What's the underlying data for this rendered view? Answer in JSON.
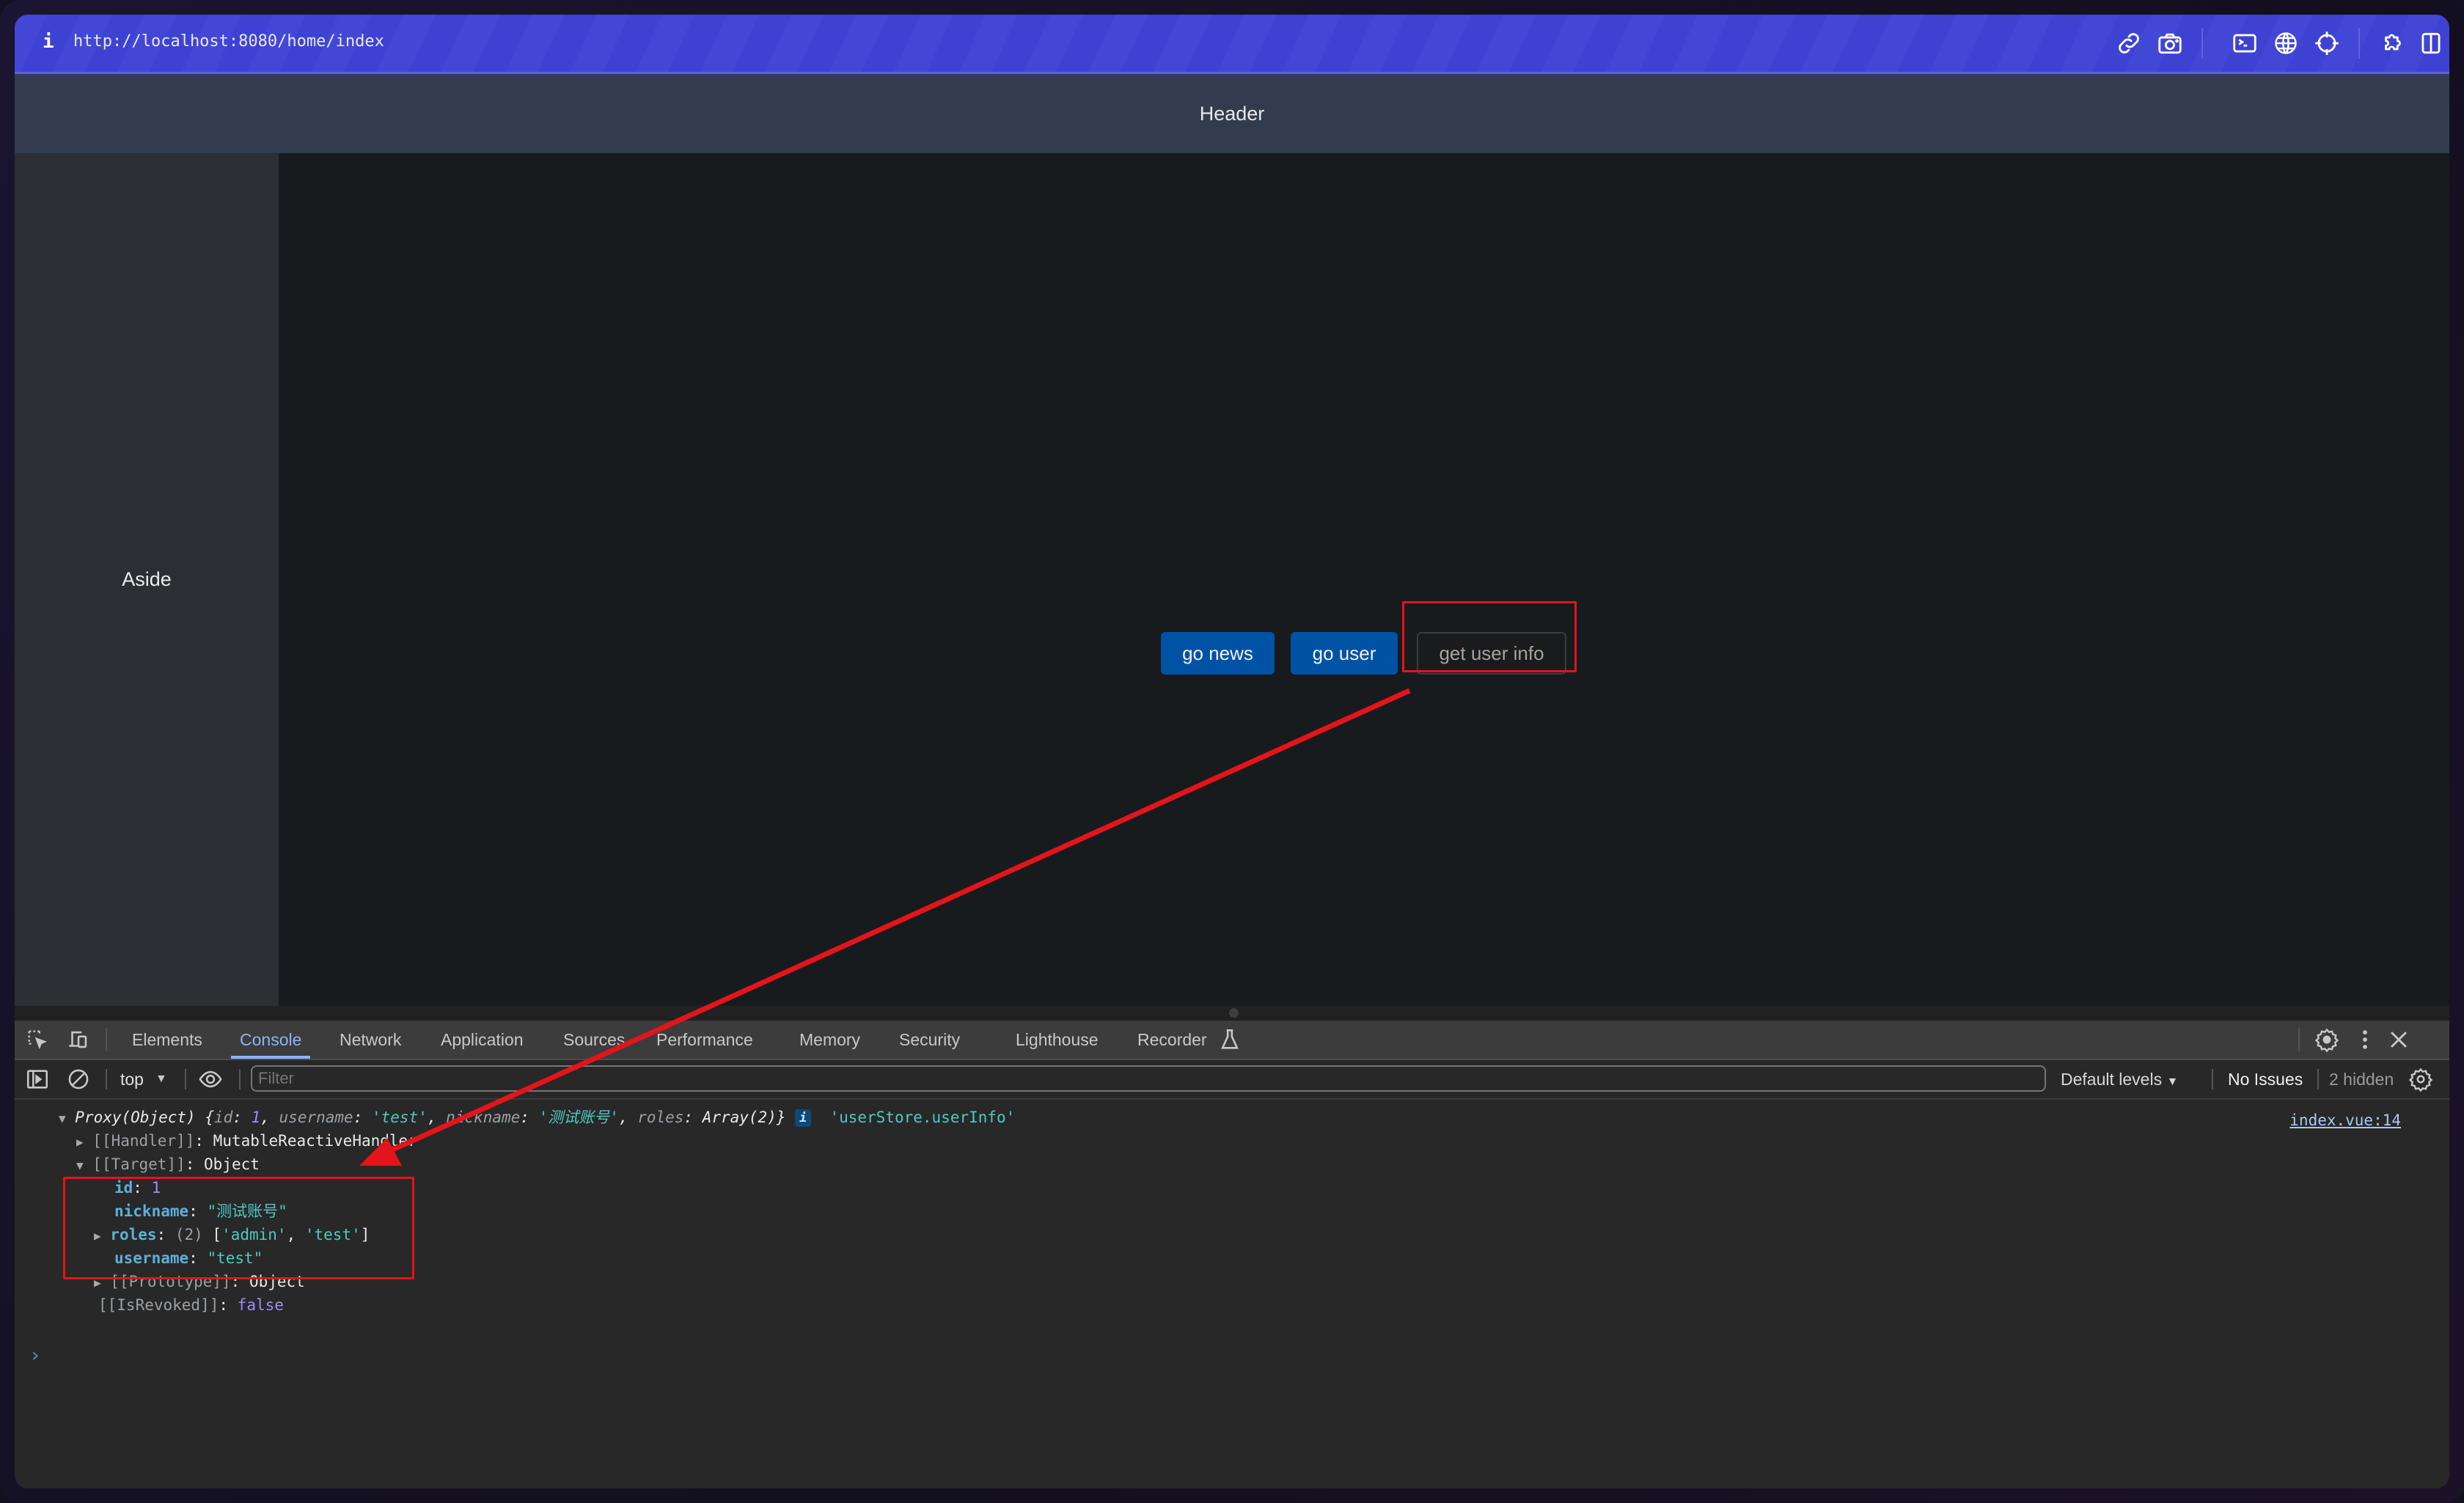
{
  "browser": {
    "info_icon": "i",
    "url": "http://localhost:8080/home/index",
    "toolbar_icons": [
      "link-icon",
      "camera-icon",
      "terminal-icon",
      "globe-icon",
      "crosshair-icon",
      "extension-icon",
      "split-view-icon"
    ]
  },
  "app": {
    "header_text": "Header",
    "aside_text": "Aside",
    "buttons": {
      "go_news": "go news",
      "go_user": "go user",
      "get_user_info": "get user info"
    }
  },
  "devtools": {
    "tabs": [
      "Elements",
      "Console",
      "Network",
      "Application",
      "Sources",
      "Performance",
      "Memory",
      "Security",
      "Lighthouse",
      "Recorder"
    ],
    "active_tab": "Console",
    "toolbar": {
      "context": "top",
      "filter_placeholder": "Filter",
      "levels": "Default levels",
      "issues": "No Issues",
      "hidden": "2 hidden"
    },
    "console": {
      "source_link": "index.vue:14",
      "summary": {
        "prefix": "Proxy(Object)",
        "open": "{",
        "id_key": "id",
        "id_val": "1",
        "username_key": "username",
        "username_val": "'test'",
        "nickname_key": "nickname",
        "nickname_val": "'测试账号'",
        "roles_key": "roles",
        "roles_val": "Array(2)",
        "close": "}",
        "info_badge": "i",
        "label": "'userStore.userInfo'"
      },
      "handler": {
        "key": "[[Handler]]",
        "value": "MutableReactiveHandler"
      },
      "target": {
        "key": "[[Target]]",
        "value": "Object"
      },
      "fields": {
        "id_key": "id",
        "id_val": "1",
        "nickname_key": "nickname",
        "nickname_val": "\"测试账号\"",
        "roles_key": "roles",
        "roles_count": "(2)",
        "roles_open": "[",
        "roles_item1": "'admin'",
        "roles_item2": "'test'",
        "roles_close": "]",
        "username_key": "username",
        "username_val": "\"test\""
      },
      "prototype": {
        "key": "[[Prototype]]",
        "value": "Object"
      },
      "revoked": {
        "key": "[[IsRevoked]]",
        "value": "false"
      },
      "prompt": "›"
    }
  },
  "annotations": {
    "color": "#e3141b"
  }
}
